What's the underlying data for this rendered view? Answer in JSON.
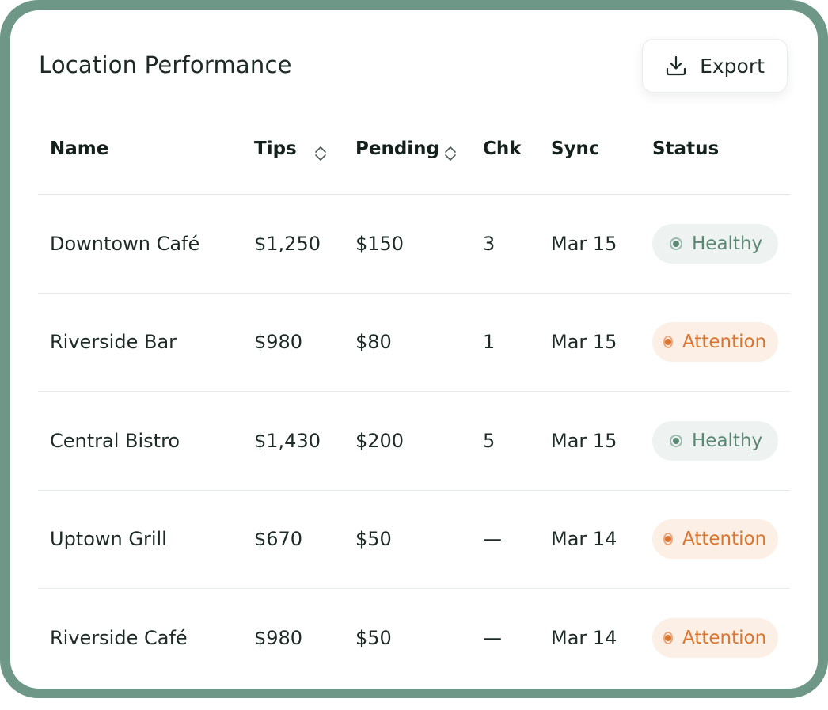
{
  "card": {
    "title": "Location Performance",
    "export_label": "Export"
  },
  "colors": {
    "frame": "#6e9787",
    "healthy_text": "#5b8874",
    "healthy_bg": "#eef2f0",
    "attention_text": "#d9752f",
    "attention_bg": "#fcefe5"
  },
  "icons": {
    "export": "download-icon",
    "sort": "sort-icon",
    "status": "status-dot-icon"
  },
  "table": {
    "headers": {
      "name": "Name",
      "tips": "Tips",
      "pending": "Pending",
      "chk": "Chk",
      "sync": "Sync",
      "status": "Status"
    },
    "rows": [
      {
        "name": "Downtown Café",
        "tips": "$1,250",
        "pending": "$150",
        "chk": "3",
        "sync": "Mar 15",
        "status": "Healthy",
        "status_type": "healthy"
      },
      {
        "name": "Riverside Bar",
        "tips": "$980",
        "pending": "$80",
        "chk": "1",
        "sync": "Mar 15",
        "status": "Attention",
        "status_type": "attention"
      },
      {
        "name": "Central Bistro",
        "tips": "$1,430",
        "pending": "$200",
        "chk": "5",
        "sync": "Mar 15",
        "status": "Healthy",
        "status_type": "healthy"
      },
      {
        "name": "Uptown Grill",
        "tips": "$670",
        "pending": "$50",
        "chk": "—",
        "sync": "Mar 14",
        "status": "Attention",
        "status_type": "attention"
      },
      {
        "name": "Riverside Café",
        "tips": "$980",
        "pending": "$50",
        "chk": "—",
        "sync": "Mar 14",
        "status": "Attention",
        "status_type": "attention"
      }
    ]
  }
}
